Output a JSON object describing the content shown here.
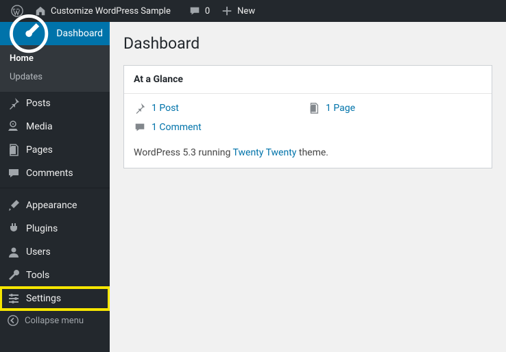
{
  "adminbar": {
    "site_title": "Customize WordPress Sample",
    "comment_count": "0",
    "new_label": "New"
  },
  "sidebar": {
    "dashboard": "Dashboard",
    "home": "Home",
    "updates": "Updates",
    "posts": "Posts",
    "media": "Media",
    "pages": "Pages",
    "comments": "Comments",
    "appearance": "Appearance",
    "plugins": "Plugins",
    "users": "Users",
    "tools": "Tools",
    "settings": "Settings",
    "collapse": "Collapse menu"
  },
  "page": {
    "title": "Dashboard"
  },
  "glance": {
    "heading": "At a Glance",
    "posts": "1 Post",
    "comments": "1 Comment",
    "pages": "1 Page",
    "theme_prefix": "WordPress 5.3 running ",
    "theme_name": "Twenty Twenty",
    "theme_suffix": " theme."
  }
}
